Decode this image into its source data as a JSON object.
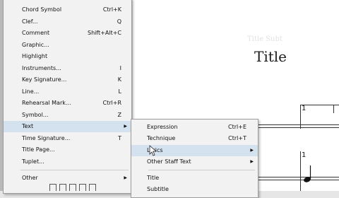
{
  "score": {
    "title": "Title",
    "faint_text": "Title Subt",
    "measure_numbers": [
      "1",
      "1",
      "1"
    ]
  },
  "main_menu": {
    "items": [
      {
        "label": "Chord Symbol",
        "shortcut": "Ctrl+K",
        "submenu": false
      },
      {
        "label": "Clef...",
        "shortcut": "Q",
        "submenu": false
      },
      {
        "label": "Comment",
        "shortcut": "Shift+Alt+C",
        "submenu": false
      },
      {
        "label": "Graphic...",
        "shortcut": "",
        "submenu": false
      },
      {
        "label": "Highlight",
        "shortcut": "",
        "submenu": false
      },
      {
        "label": "Instruments...",
        "shortcut": "I",
        "submenu": false
      },
      {
        "label": "Key Signature...",
        "shortcut": "K",
        "submenu": false
      },
      {
        "label": "Line...",
        "shortcut": "L",
        "submenu": false
      },
      {
        "label": "Rehearsal Mark...",
        "shortcut": "Ctrl+R",
        "submenu": false
      },
      {
        "label": "Symbol...",
        "shortcut": "Z",
        "submenu": false
      },
      {
        "label": "Text",
        "shortcut": "",
        "submenu": true,
        "highlighted": true
      },
      {
        "label": "Time Signature...",
        "shortcut": "T",
        "submenu": false
      },
      {
        "label": "Title Page...",
        "shortcut": "",
        "submenu": false
      },
      {
        "label": "Tuplet...",
        "shortcut": "",
        "submenu": false
      },
      {
        "label": "Other",
        "shortcut": "",
        "submenu": true
      }
    ]
  },
  "text_submenu": {
    "items": [
      {
        "label": "Expression",
        "shortcut": "Ctrl+E",
        "submenu": false
      },
      {
        "label": "Technique",
        "shortcut": "Ctrl+T",
        "submenu": false
      },
      {
        "label": "Lyrics",
        "shortcut": "",
        "submenu": true,
        "highlighted": true
      },
      {
        "label": "Other Staff Text",
        "shortcut": "",
        "submenu": true
      },
      {
        "label": "Title",
        "shortcut": "",
        "submenu": false
      },
      {
        "label": "Subtitle",
        "shortcut": "",
        "submenu": false
      }
    ]
  },
  "icons": {
    "submenu_arrow": "chevron-right-icon",
    "cursor": "mouse-pointer-icon"
  },
  "colors": {
    "menu_bg": "#f2f2f2",
    "highlight": "#d4e2f0",
    "score_bg": "#ffffff"
  }
}
